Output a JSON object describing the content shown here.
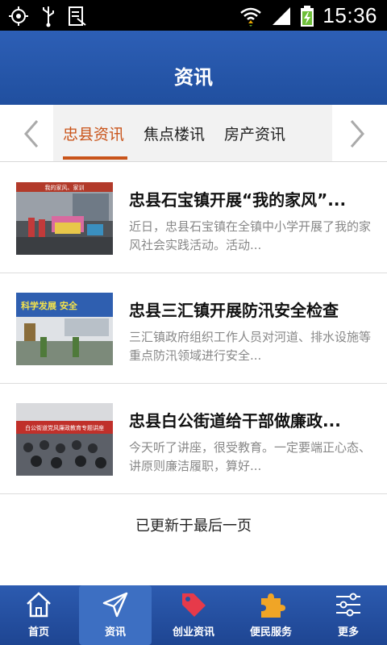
{
  "status_bar": {
    "time": "15:36",
    "icons": [
      "gps-icon",
      "usb-icon",
      "reader-mode-icon",
      "wifi-icon",
      "signal-icon",
      "battery-charging-icon"
    ]
  },
  "header": {
    "title": "资讯"
  },
  "tabs": {
    "items": [
      {
        "label": "忠县资讯",
        "active": true
      },
      {
        "label": "焦点楼讯",
        "active": false
      },
      {
        "label": "房产资讯",
        "active": false
      }
    ],
    "left_arrow": "chevron-left-icon",
    "right_arrow": "chevron-right-icon"
  },
  "articles": [
    {
      "title": "忠县石宝镇开展“我的家风”...",
      "summary": "近日，忠县石宝镇在全镇中小学开展了我的家风社会实践活动。活动...",
      "thumbnail": "stage-performance-photo",
      "banner_text": "我的家风、家训"
    },
    {
      "title": "忠县三汇镇开展防汛安全检查",
      "summary": "三汇镇政府组织工作人员对河道、排水设施等重点防汛领域进行安全...",
      "thumbnail": "town-banner-photo",
      "banner_text": "科学发展 安全"
    },
    {
      "title": "忠县白公街道给干部做廉政...",
      "summary": "今天听了讲座，很受教育。一定要端正心态、讲原则廉洁履职，算好...",
      "thumbnail": "lecture-hall-photo",
      "banner_text": "白公街道党风廉政教育专题讲座"
    }
  ],
  "list_footer": "已更新于最后一页",
  "bottom_nav": [
    {
      "label": "首页",
      "icon": "home-icon",
      "active": false
    },
    {
      "label": "资讯",
      "icon": "paper-plane-icon",
      "active": true
    },
    {
      "label": "创业资讯",
      "icon": "tag-icon",
      "active": false
    },
    {
      "label": "便民服务",
      "icon": "puzzle-icon",
      "active": false
    },
    {
      "label": "更多",
      "icon": "sliders-icon",
      "active": false
    }
  ],
  "colors": {
    "header_blue": "#2457a8",
    "accent_orange": "#c9541a",
    "nav_blue": "#2451a2"
  }
}
